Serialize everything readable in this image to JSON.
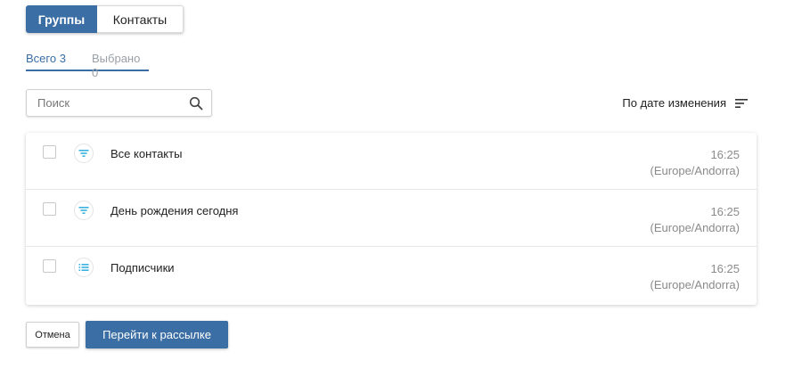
{
  "tabs": {
    "groups": "Группы",
    "contacts": "Контакты"
  },
  "subtabs": {
    "all": "Всего 3",
    "selected": "Выбрано 0"
  },
  "search": {
    "placeholder": "Поиск"
  },
  "sort": {
    "label": "По дате изменения",
    "icon": "sort-lines-icon"
  },
  "rows": [
    {
      "name": "Все контакты",
      "time": "16:25",
      "zone": "(Europe/Andorra)",
      "icon": "filter-icon"
    },
    {
      "name": "День рождения сегодня",
      "time": "16:25",
      "zone": "(Europe/Andorra)",
      "icon": "filter-icon"
    },
    {
      "name": "Подписчики",
      "time": "16:25",
      "zone": "(Europe/Andorra)",
      "icon": "list-icon"
    }
  ],
  "buttons": {
    "cancel": "Отмена",
    "go": "Перейти к рассылке"
  },
  "colors": {
    "accent": "#3a6ea5",
    "icon": "#3ab0e0"
  }
}
